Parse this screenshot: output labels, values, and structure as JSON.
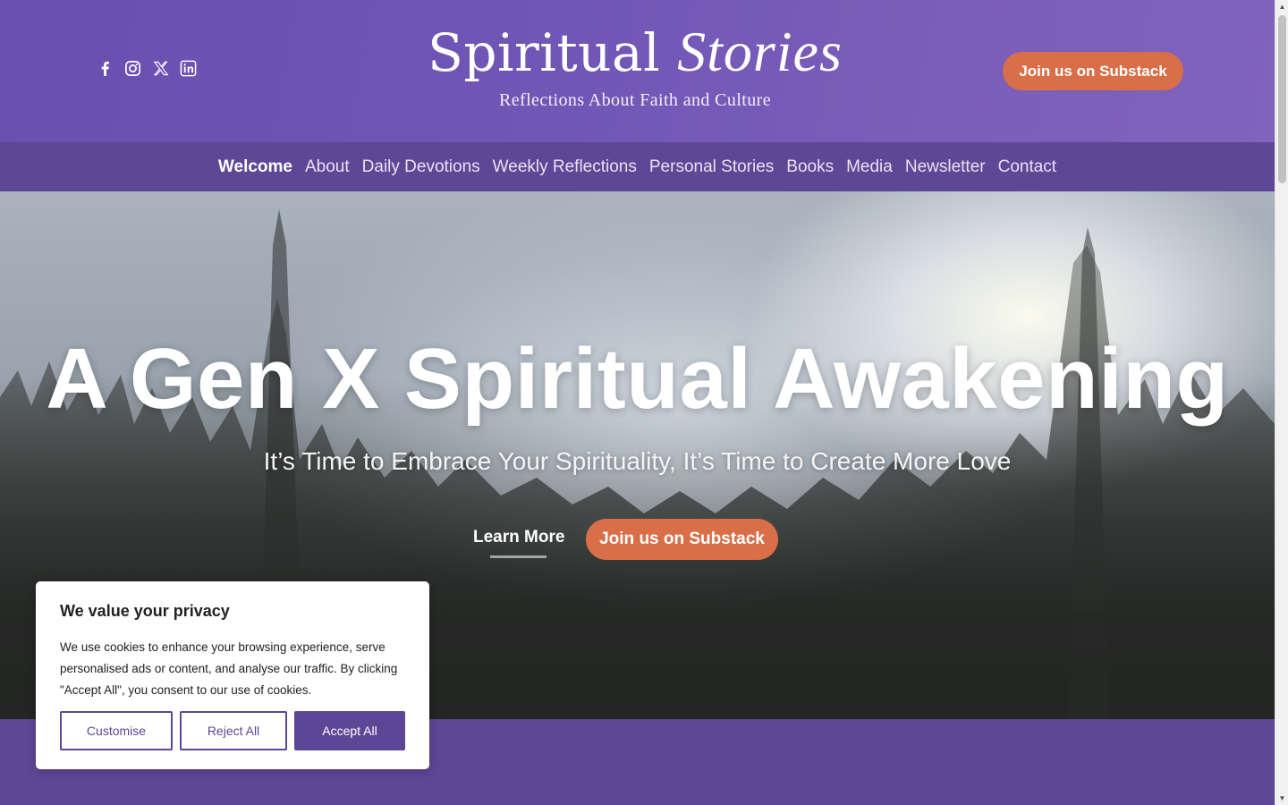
{
  "header": {
    "social_icons": [
      "facebook-icon",
      "instagram-icon",
      "x-icon",
      "linkedin-icon"
    ],
    "brand_title_main": "Spiritual",
    "brand_title_script": "Stories",
    "brand_subtitle": "Reflections About Faith and Culture",
    "cta_label": "Join us on Substack"
  },
  "nav": {
    "items": [
      {
        "label": "Welcome",
        "active": true
      },
      {
        "label": "About"
      },
      {
        "label": "Daily Devotions"
      },
      {
        "label": "Weekly Reflections"
      },
      {
        "label": "Personal Stories"
      },
      {
        "label": "Books"
      },
      {
        "label": "Media"
      },
      {
        "label": "Newsletter"
      },
      {
        "label": "Contact"
      }
    ]
  },
  "hero": {
    "title": "A Gen X Spiritual Awakening",
    "subtitle": "It’s Time to Embrace Your Spirituality, It’s Time to Create More Love",
    "learn_more_label": "Learn More",
    "cta_label": "Join us on Substack"
  },
  "cookie_banner": {
    "title": "We value your privacy",
    "text": "We use cookies to enhance your browsing experience, serve personalised ads or content, and analyse our traffic. By clicking \"Accept All\", you consent to our use of cookies.",
    "customise_label": "Customise",
    "reject_label": "Reject All",
    "accept_label": "Accept All"
  },
  "colors": {
    "brand_purple": "#5e4896",
    "header_purple": "#7256b6",
    "cta_orange": "#d96f48"
  }
}
